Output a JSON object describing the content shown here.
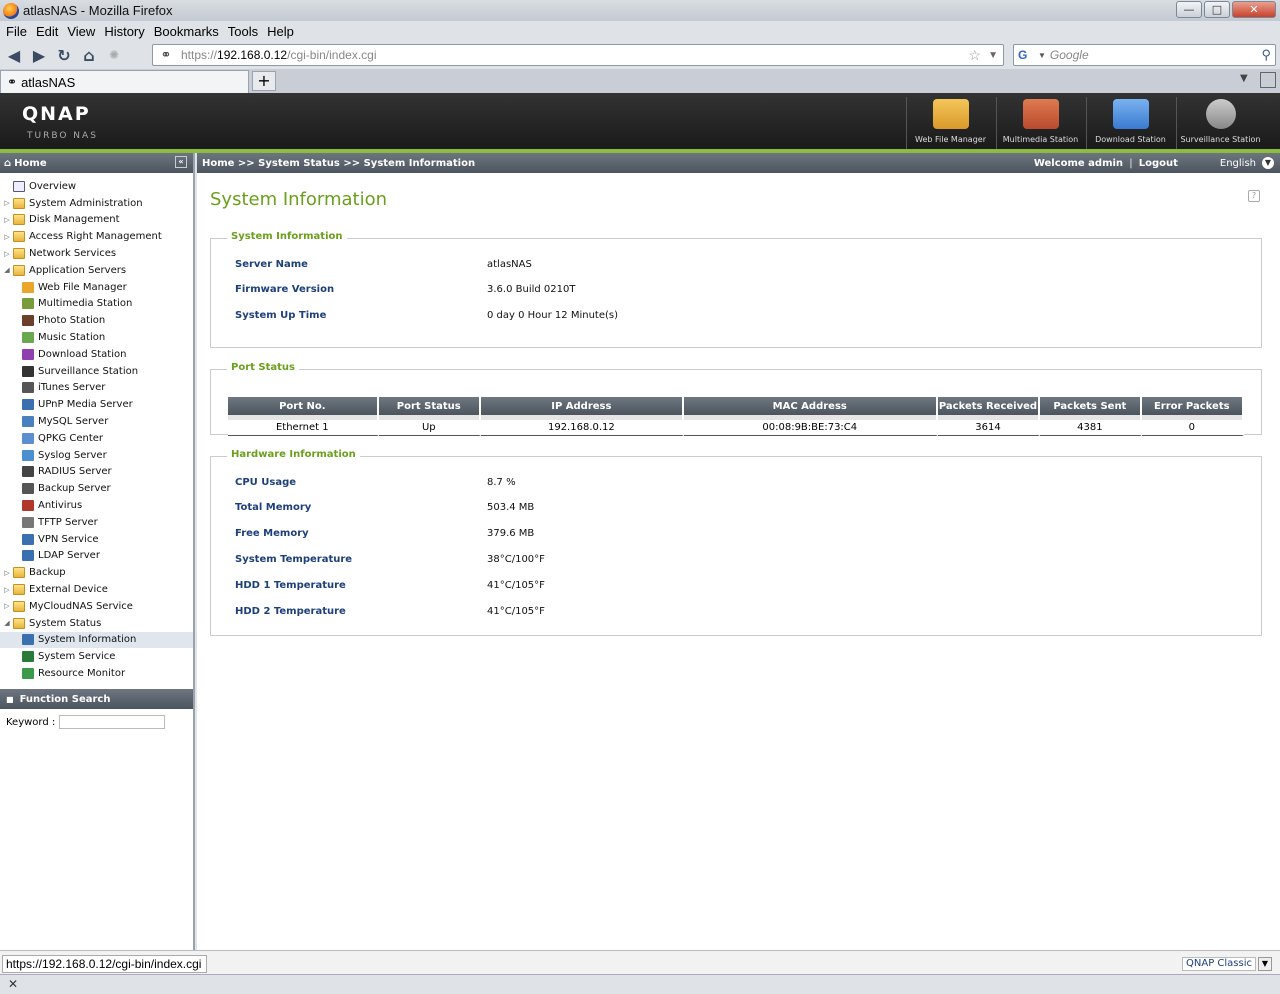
{
  "window": {
    "title": "atlasNAS - Mozilla Firefox"
  },
  "menu": [
    "File",
    "Edit",
    "View",
    "History",
    "Bookmarks",
    "Tools",
    "Help"
  ],
  "addressbar": {
    "scheme": "https://",
    "host": "192.168.0.12",
    "path": "/cgi-bin/index.cgi"
  },
  "search": {
    "placeholder": "Google"
  },
  "tab": {
    "label": "atlasNAS"
  },
  "header": {
    "logo": "QNAP",
    "sublogo": "TURBO NAS",
    "stations": [
      {
        "label": "Web File Manager",
        "icon": "web-file-manager-icon",
        "color": "#d99a2a"
      },
      {
        "label": "Multimedia Station",
        "icon": "multimedia-station-icon",
        "color": "#b84a2f"
      },
      {
        "label": "Download Station",
        "icon": "download-station-icon",
        "color": "#3a7ad0"
      },
      {
        "label": "Surveillance Station",
        "icon": "surveillance-station-icon",
        "color": "#888888"
      }
    ]
  },
  "sidebar": {
    "home_label": "Home",
    "tree": [
      {
        "label": "Overview",
        "type": "item",
        "icon": "overview-icon"
      },
      {
        "label": "System Administration",
        "type": "folder"
      },
      {
        "label": "Disk Management",
        "type": "folder"
      },
      {
        "label": "Access Right Management",
        "type": "folder"
      },
      {
        "label": "Network Services",
        "type": "folder"
      },
      {
        "label": "Application Servers",
        "type": "folder",
        "expanded": true
      },
      {
        "label": "Web File Manager",
        "type": "child",
        "color": "#e9a62b"
      },
      {
        "label": "Multimedia Station",
        "type": "child",
        "color": "#7a9b3a"
      },
      {
        "label": "Photo Station",
        "type": "child",
        "color": "#6b3f2a"
      },
      {
        "label": "Music Station",
        "type": "child",
        "color": "#6aa84f"
      },
      {
        "label": "Download Station",
        "type": "child",
        "color": "#8e3fb0"
      },
      {
        "label": "Surveillance Station",
        "type": "child",
        "color": "#333333"
      },
      {
        "label": "iTunes Server",
        "type": "child",
        "color": "#555555"
      },
      {
        "label": "UPnP Media Server",
        "type": "child",
        "color": "#3a6fb0"
      },
      {
        "label": "MySQL Server",
        "type": "child",
        "color": "#4a7fc0"
      },
      {
        "label": "QPKG Center",
        "type": "child",
        "color": "#5b8fd0"
      },
      {
        "label": "Syslog Server",
        "type": "child",
        "color": "#4a90d0"
      },
      {
        "label": "RADIUS Server",
        "type": "child",
        "color": "#444444"
      },
      {
        "label": "Backup Server",
        "type": "child",
        "color": "#555555"
      },
      {
        "label": "Antivirus",
        "type": "child",
        "color": "#b0382a"
      },
      {
        "label": "TFTP Server",
        "type": "child",
        "color": "#777777"
      },
      {
        "label": "VPN Service",
        "type": "child",
        "color": "#3a6fb0"
      },
      {
        "label": "LDAP Server",
        "type": "child",
        "color": "#3a6fb0"
      },
      {
        "label": "Backup",
        "type": "folder"
      },
      {
        "label": "External Device",
        "type": "folder"
      },
      {
        "label": "MyCloudNAS Service",
        "type": "folder"
      },
      {
        "label": "System Status",
        "type": "folder",
        "expanded": true
      },
      {
        "label": "System Information",
        "type": "child",
        "color": "#3a6fb0",
        "active": true
      },
      {
        "label": "System Service",
        "type": "child",
        "color": "#2a7a3a"
      },
      {
        "label": "Resource Monitor",
        "type": "child",
        "color": "#3a9a4a"
      }
    ],
    "function_search": {
      "title": "Function Search",
      "keyword_label": "Keyword :"
    }
  },
  "topbar": {
    "breadcrumb": "Home >> System Status >> System Information",
    "welcome": "Welcome admin",
    "logout": "Logout",
    "language": "English"
  },
  "page": {
    "title": "System Information",
    "system_info": {
      "legend": "System Information",
      "rows": [
        {
          "key": "Server Name",
          "value": "atlasNAS"
        },
        {
          "key": "Firmware Version",
          "value": "3.6.0 Build 0210T"
        },
        {
          "key": "System Up Time",
          "value": "0 day 0 Hour 12 Minute(s)"
        }
      ]
    },
    "port_status": {
      "legend": "Port Status",
      "headers": [
        "Port No.",
        "Port Status",
        "IP Address",
        "MAC Address",
        "Packets Received",
        "Packets Sent",
        "Error Packets"
      ],
      "rows": [
        [
          "Ethernet 1",
          "Up",
          "192.168.0.12",
          "00:08:9B:BE:73:C4",
          "3614",
          "4381",
          "0"
        ]
      ]
    },
    "hardware_info": {
      "legend": "Hardware Information",
      "rows": [
        {
          "key": "CPU Usage",
          "value": "8.7 %"
        },
        {
          "key": "Total Memory",
          "value": "503.4 MB"
        },
        {
          "key": "Free Memory",
          "value": "379.6 MB"
        },
        {
          "key": "System Temperature",
          "value": "38°C/100°F"
        },
        {
          "key": "HDD 1 Temperature",
          "value": "41°C/105°F"
        },
        {
          "key": "HDD 2 Temperature",
          "value": "41°C/105°F"
        }
      ]
    }
  },
  "statusbar": {
    "url": "https://192.168.0.12/cgi-bin/index.cgi",
    "theme": "QNAP Classic"
  }
}
